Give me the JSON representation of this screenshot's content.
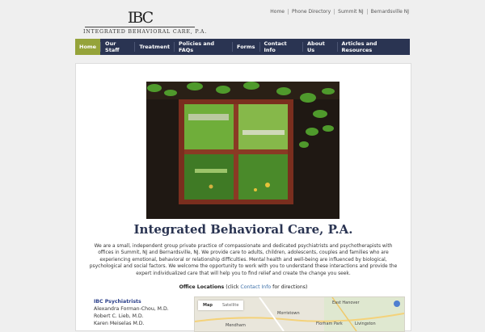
{
  "utility_links": [
    "Home",
    "Phone Directory",
    "Summit NJ",
    "Bernardsville NJ"
  ],
  "logo": {
    "mark": "IBC",
    "name": "INTEGRATED BEHAVIORAL CARE, P.A."
  },
  "nav": {
    "items": [
      "Home",
      "Our Staff",
      "Treatment",
      "Policies and FAQs",
      "Forms",
      "Contact Info",
      "About Us",
      "Articles and Resources"
    ],
    "active": "Home"
  },
  "main": {
    "title": "Integrated Behavioral Care, P.A.",
    "intro": "We are a small, independent group private practice of compassionate and dedicated psychiatrists and psychotherapists with offices in Summit, NJ and Bernardsville, NJ. We provide care to adults, children, adolescents, couples and families who are experiencing emotional, behavioral or relationship difficulties. Mental health and well-being are influenced by biological, psychological and social factors. We welcome the opportunity to work with you to understand these interactions and provide the expert individualized care that will help you to find relief and create the change you seek.",
    "office": {
      "label": "Office Locations",
      "before": "(click ",
      "link": "Contact Info",
      "after": " for directions)"
    },
    "staff": {
      "title": "IBC Psychiatrists",
      "names": [
        "Alexandra Forman-Chou, M.D.",
        "Robert C. Lieb, M.D.",
        "Karen Meiselas M.D."
      ]
    },
    "map": {
      "tabs": [
        "Map",
        "Satellite"
      ],
      "places": [
        "East Hanover",
        "Morristown",
        "Florham Park",
        "Livingston",
        "Mendham"
      ]
    }
  }
}
